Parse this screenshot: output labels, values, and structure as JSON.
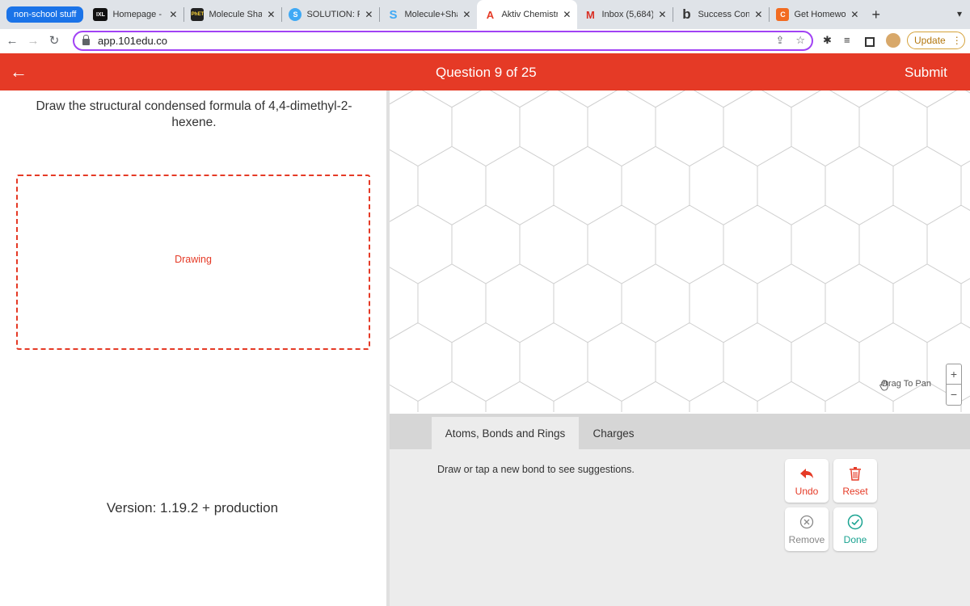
{
  "browser": {
    "tab_group": "non-school stuff",
    "tabs": [
      {
        "title": "Homepage - S",
        "favicon": "IXL"
      },
      {
        "title": "Molecule Shap",
        "favicon": "PhET"
      },
      {
        "title": "SOLUTION: Pd",
        "favicon": "S"
      },
      {
        "title": "Molecule+Sha",
        "favicon": "S"
      },
      {
        "title": "Aktiv Chemistr",
        "favicon": "A"
      },
      {
        "title": "Inbox (5,684)",
        "favicon": "M"
      },
      {
        "title": "Success Confi",
        "favicon": "b"
      },
      {
        "title": "Get Homework",
        "favicon": "C"
      }
    ],
    "active_tab_index": 4,
    "url": "app.101edu.co",
    "update_label": "Update"
  },
  "app": {
    "question_label": "Question 9 of 25",
    "submit_label": "Submit",
    "question_text": "Draw the structural condensed formula of 4,4-dimethyl-2-hexene.",
    "drawing_label": "Drawing",
    "version_label": "Version: 1.19.2 +",
    "version_env": "production",
    "pan_hint": "Drag To Pan",
    "zoom_in": "+",
    "zoom_out": "−",
    "tool_tabs": [
      "Atoms, Bonds and Rings",
      "Charges"
    ],
    "active_tool_tab": 0,
    "suggestion_hint": "Draw or tap a new bond to see suggestions.",
    "actions": {
      "undo": "Undo",
      "reset": "Reset",
      "remove": "Remove",
      "done": "Done"
    },
    "colors": {
      "brand_red": "#e53a26",
      "done_teal": "#1aa391",
      "remove_gray": "#888888"
    }
  }
}
